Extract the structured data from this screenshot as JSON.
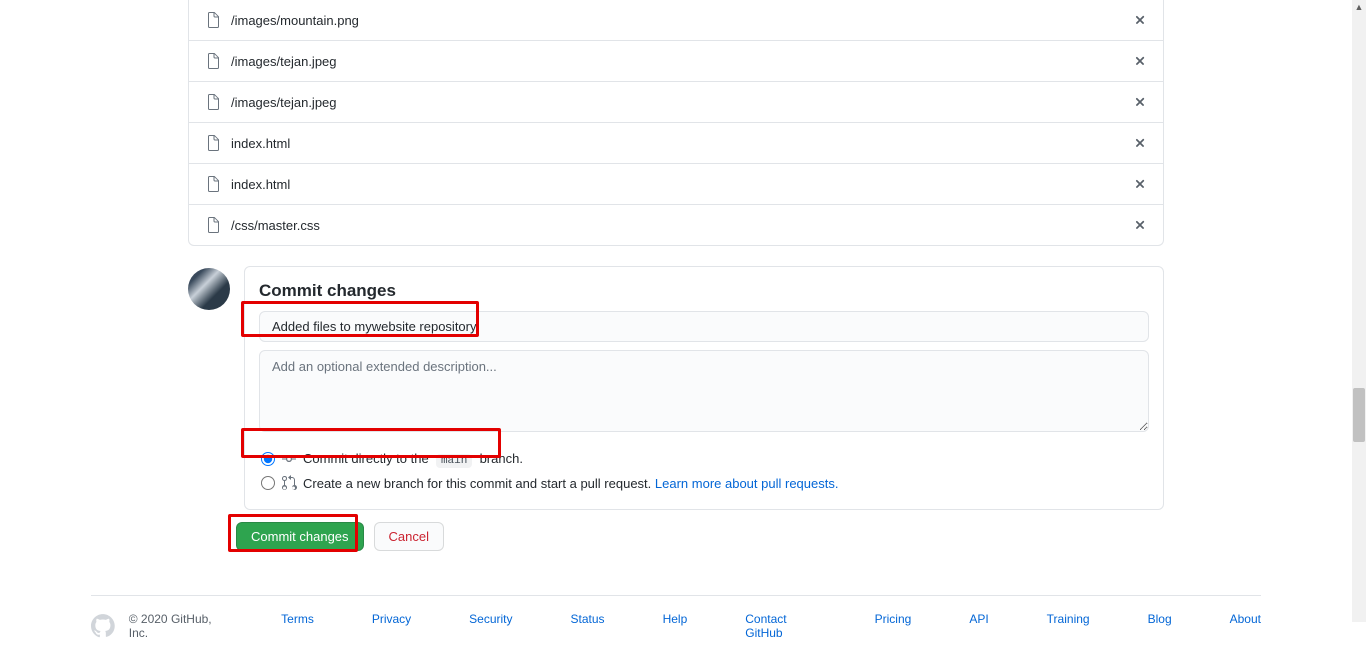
{
  "files": [
    {
      "path": "/images/mountain.png"
    },
    {
      "path": "/images/tejan.jpeg"
    },
    {
      "path": "/images/tejan.jpeg"
    },
    {
      "path": "index.html"
    },
    {
      "path": "index.html"
    },
    {
      "path": "/css/master.css"
    }
  ],
  "commit": {
    "heading": "Commit changes",
    "summary": "Added files to mywebsite repository",
    "description_placeholder": "Add an optional extended description...",
    "option_direct_prefix": "Commit directly to the",
    "option_direct_branch": "main",
    "option_direct_suffix": "branch.",
    "option_newbranch": "Create a new branch for this commit and start a pull request.",
    "learn_more": "Learn more about pull requests.",
    "selected_option": "direct"
  },
  "actions": {
    "commit": "Commit changes",
    "cancel": "Cancel"
  },
  "footer": {
    "copyright": "© 2020 GitHub, Inc.",
    "links": [
      "Terms",
      "Privacy",
      "Security",
      "Status",
      "Help",
      "Contact GitHub",
      "Pricing",
      "API",
      "Training",
      "Blog",
      "About"
    ]
  }
}
